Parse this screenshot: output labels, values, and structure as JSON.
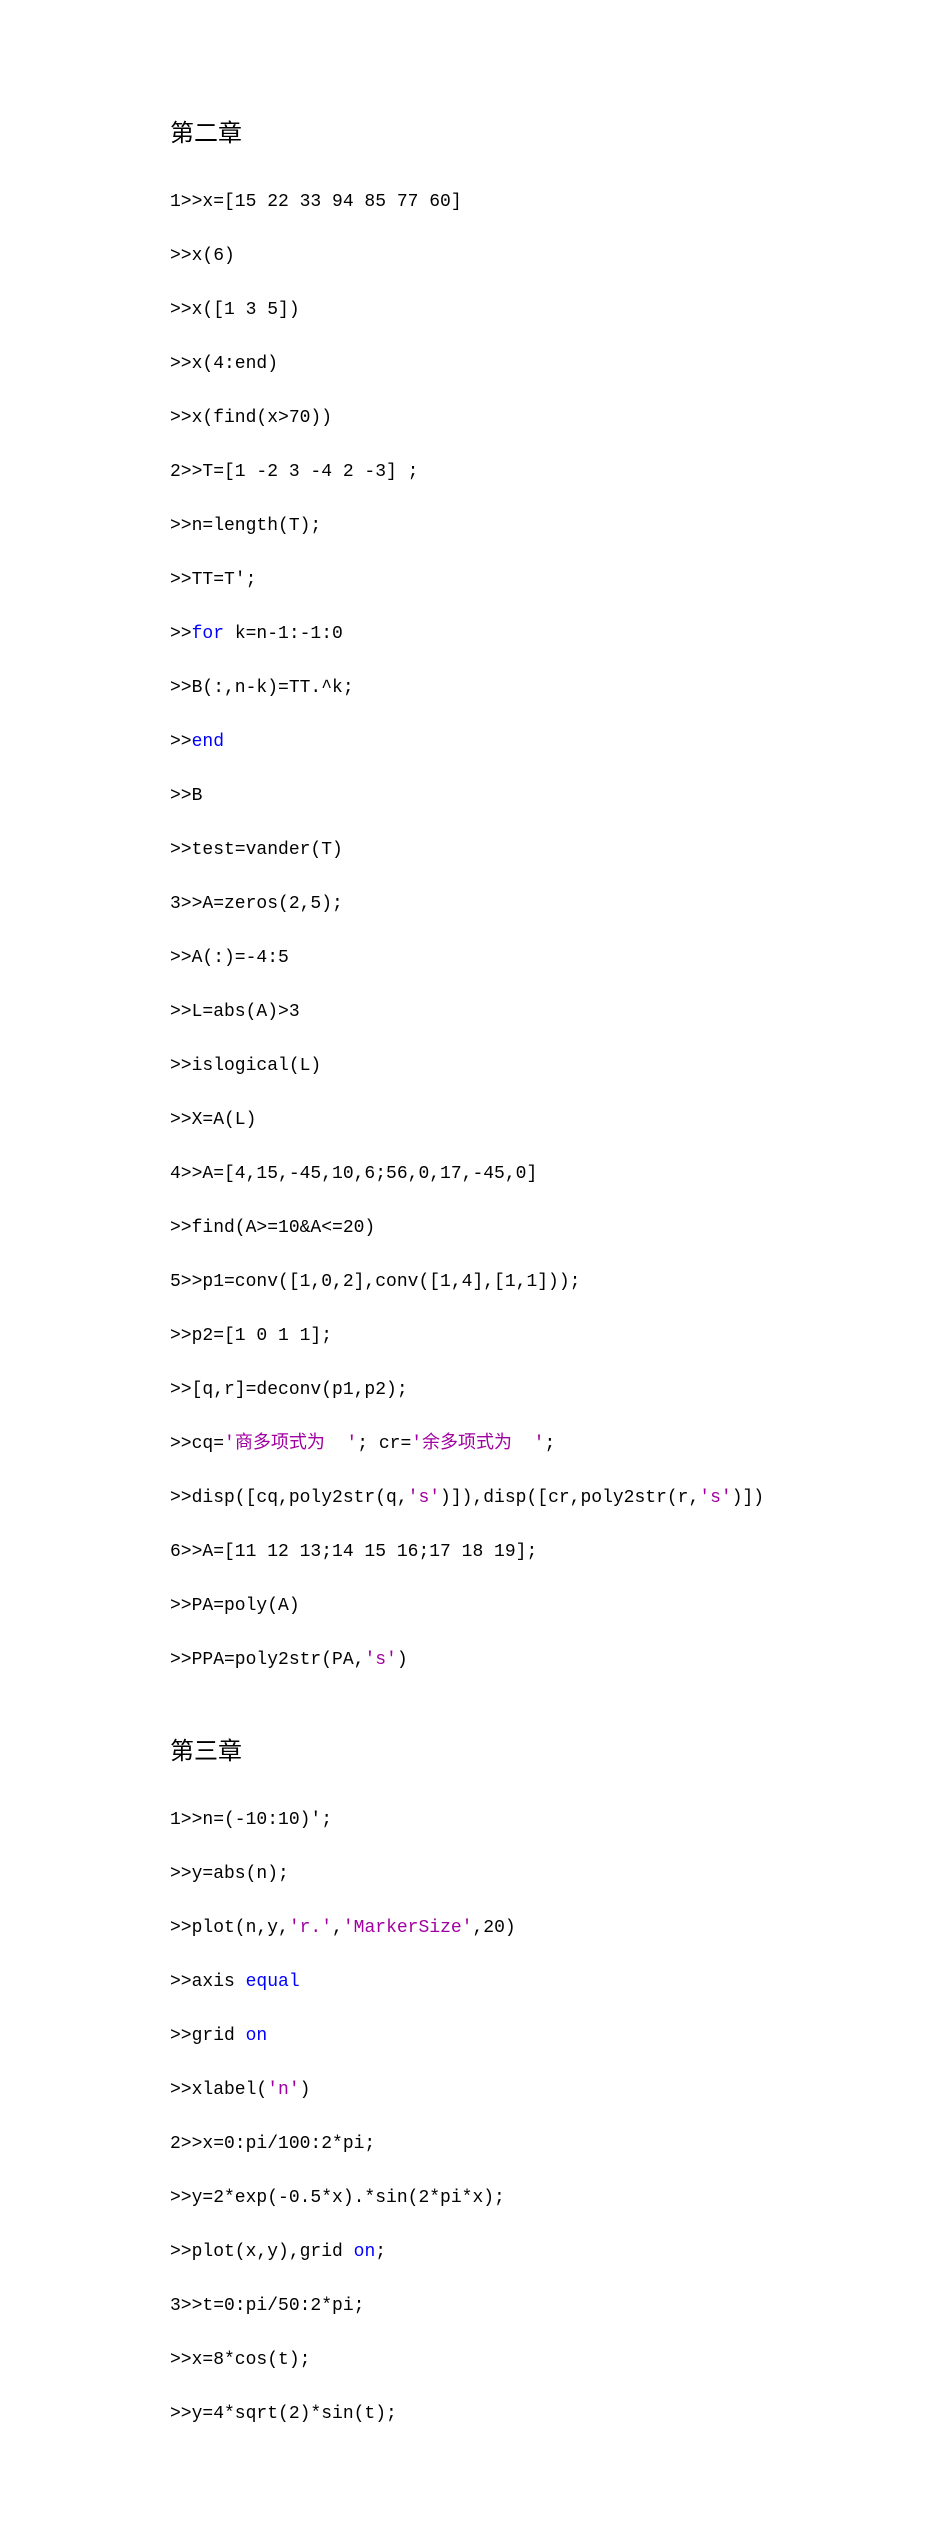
{
  "headings": {
    "ch2": "第二章",
    "ch3": "第三章"
  },
  "code": {
    "l01": "1>>x=[15 22 33 94 85 77 60]",
    "l02": ">>x(6)",
    "l03": ">>x([1 3 5])",
    "l04": ">>x(4:end)",
    "l05": ">>x(find(x>70))",
    "l06": "2>>T=[1 -2 3 -4 2 -3] ;",
    "l07": ">>n=length(T);",
    "l08": ">>TT=T';",
    "l09a": ">>",
    "l09b": "for",
    "l09c": " k=n-1:-1:0",
    "l10": ">>B(:,n-k)=TT.^k;",
    "l11a": ">>",
    "l11b": "end",
    "l12": ">>B",
    "l13": ">>test=vander(T)",
    "l14": "3>>A=zeros(2,5);",
    "l15": ">>A(:)=-4:5",
    "l16": ">>L=abs(A)>3",
    "l17": ">>islogical(L)",
    "l18": ">>X=A(L)",
    "l19": "4>>A=[4,15,-45,10,6;56,0,17,-45,0]",
    "l20": ">>find(A>=10&A<=20)",
    "l21": "5>>p1=conv([1,0,2],conv([1,4],[1,1]));",
    "l22": ">>p2=[1 0 1 1];",
    "l23": ">>[q,r]=deconv(p1,p2);",
    "l24a": ">>cq=",
    "l24b": "'商多项式为  '",
    "l24c": "; cr=",
    "l24d": "'余多项式为  '",
    "l24e": ";",
    "l25a": ">>disp([cq,poly2str(q,",
    "l25b": "'s'",
    "l25c": ")]),disp([cr,poly2str(r,",
    "l25d": "'s'",
    "l25e": ")])",
    "l26": "6>>A=[11 12 13;14 15 16;17 18 19];",
    "l27": ">>PA=poly(A)",
    "l28a": ">>PPA=poly2str(PA,",
    "l28b": "'s'",
    "l28c": ")",
    "l29": "1>>n=(-10:10)';",
    "l30": ">>y=abs(n);",
    "l31a": ">>plot(n,y,",
    "l31b": "'r.'",
    "l31c": ",",
    "l31d": "'MarkerSize'",
    "l31e": ",20)",
    "l32a": ">>axis ",
    "l32b": "equal",
    "l33a": ">>grid ",
    "l33b": "on",
    "l34a": ">>xlabel(",
    "l34b": "'n'",
    "l34c": ")",
    "l35": "2>>x=0:pi/100:2*pi;",
    "l36": ">>y=2*exp(-0.5*x).*sin(2*pi*x);",
    "l37a": ">>plot(x,y),grid ",
    "l37b": "on",
    "l37c": ";",
    "l38": "3>>t=0:pi/50:2*pi;",
    "l39": ">>x=8*cos(t);",
    "l40": ">>y=4*sqrt(2)*sin(t);"
  }
}
